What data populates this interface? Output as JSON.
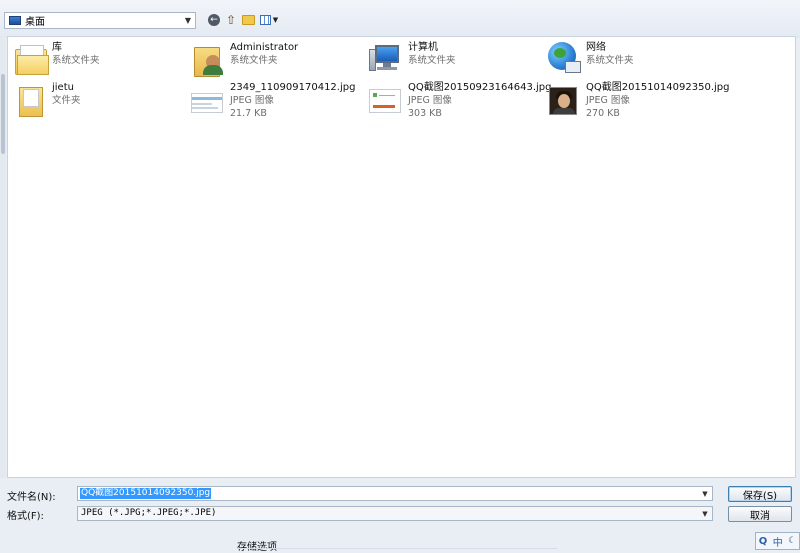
{
  "toolbar": {
    "location": "桌面",
    "back_icon": "back-arrow-icon",
    "up_icon": "up-folder-icon",
    "new_folder_icon": "new-folder-icon",
    "views_icon": "view-menu-icon"
  },
  "items": [
    {
      "name": "库",
      "sub1": "系统文件夹",
      "sub2": "",
      "icon": "library-icon"
    },
    {
      "name": "Administrator",
      "sub1": "系统文件夹",
      "sub2": "",
      "icon": "user-folder-icon"
    },
    {
      "name": "计算机",
      "sub1": "系统文件夹",
      "sub2": "",
      "icon": "computer-icon"
    },
    {
      "name": "网络",
      "sub1": "系统文件夹",
      "sub2": "",
      "icon": "network-icon"
    },
    {
      "name": "jietu",
      "sub1": "文件夹",
      "sub2": "",
      "icon": "folder-icon"
    },
    {
      "name": "2349_110909170412.jpg",
      "sub1": "JPEG 图像",
      "sub2": "21.7 KB",
      "icon": "image-thumbnail-icon"
    },
    {
      "name": "QQ截图20150923164643.jpg",
      "sub1": "JPEG 图像",
      "sub2": "303 KB",
      "icon": "image-thumbnail-icon"
    },
    {
      "name": "QQ截图20151014092350.jpg",
      "sub1": "JPEG 图像",
      "sub2": "270 KB",
      "icon": "image-thumbnail-icon"
    }
  ],
  "form": {
    "filename_label": "文件名(N):",
    "filename_value": "QQ截图20151014092350.jpg",
    "format_label": "格式(F):",
    "format_value": "JPEG (*.JPG;*.JPEG;*.JPE)",
    "save_button": "保存(S)",
    "cancel_button": "取消",
    "options_label": "存储选项"
  },
  "tray": {
    "a": "Q",
    "b": "中",
    "c": "☾"
  },
  "colors": {
    "selection": "#3399ff",
    "panel": "#e9eef5",
    "border": "#a9b6c6"
  }
}
